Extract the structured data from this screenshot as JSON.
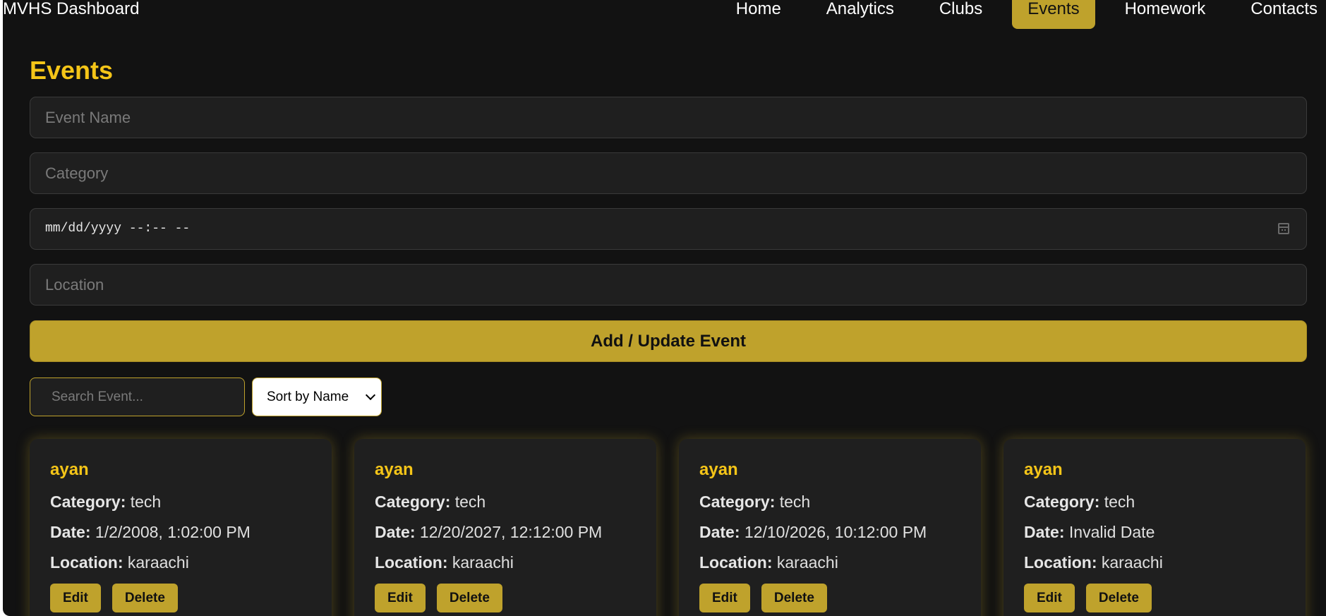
{
  "header": {
    "brand": "MVHS Dashboard",
    "nav": [
      {
        "label": "Home"
      },
      {
        "label": "Analytics"
      },
      {
        "label": "Clubs"
      },
      {
        "label": "Events",
        "active": true
      },
      {
        "label": "Homework"
      },
      {
        "label": "Contacts"
      }
    ]
  },
  "form": {
    "title": "Events",
    "event_name_placeholder": "Event Name",
    "category_placeholder": "Category",
    "datetime_placeholder": "mm/dd/yyyy --:-- --",
    "location_placeholder": "Location",
    "submit_label": "Add / Update Event"
  },
  "controls": {
    "search_placeholder": "Search Event...",
    "sort_value": "Sort by Name"
  },
  "labels": {
    "category": "Category:",
    "date": "Date:",
    "location": "Location:",
    "edit": "Edit",
    "delete": "Delete"
  },
  "events": [
    {
      "name": "ayan",
      "category": "tech",
      "date": "1/2/2008, 1:02:00 PM",
      "location": "karaachi"
    },
    {
      "name": "ayan",
      "category": "tech",
      "date": "12/20/2027, 12:12:00 PM",
      "location": "karaachi"
    },
    {
      "name": "ayan",
      "category": "tech",
      "date": "12/10/2026, 10:12:00 PM",
      "location": "karaachi"
    },
    {
      "name": "ayan",
      "category": "tech",
      "date": "Invalid Date",
      "location": "karaachi"
    }
  ],
  "colors": {
    "accent": "#bfa22c",
    "title_yellow": "#f5c518",
    "background": "#121212",
    "card": "#1f1f1f"
  }
}
